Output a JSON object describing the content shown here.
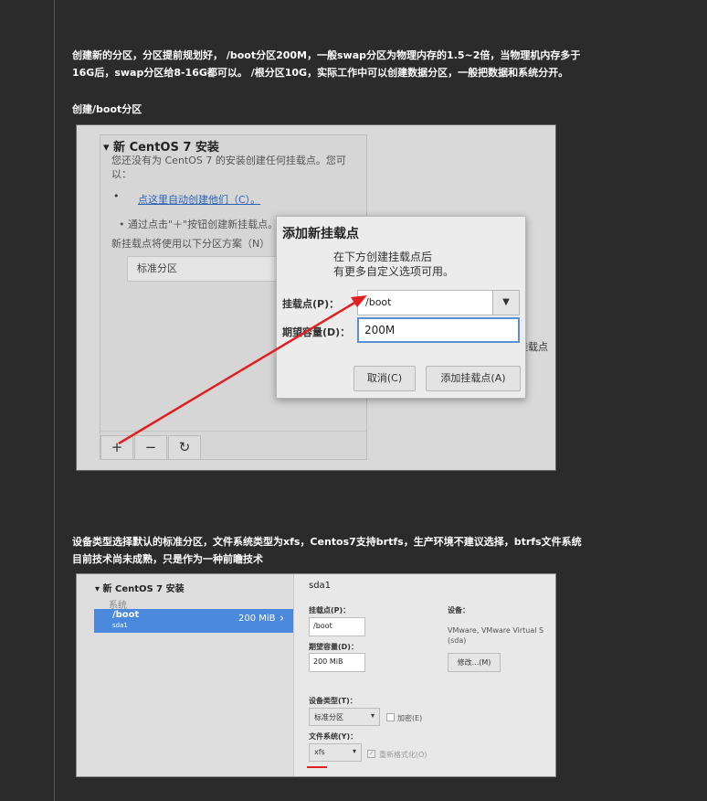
{
  "article": {
    "para1": "创建新的分区，分区提前规划好， /boot分区200M，一般swap分区为物理内存的1.5~2倍，当物理机内存多于16G后，swap分区给8-16G都可以。 /根分区10G，实际工作中可以创建数据分区，一般把数据和系统分开。",
    "heading_boot": "创建/boot分区",
    "para2": " 设备类型选择默认的标准分区，文件系统类型为xfs，Centos7支持brtfs，生产环境不建议选择，btrfs文件系统目前技术尚未成熟，只是作为一种前瞻技术"
  },
  "shot1": {
    "panel_title": "▾ 新 CentOS 7 安装",
    "panel_desc": "您还没有为 CentOS 7 的安装创建任何挂载点。您可以：",
    "bullet": "•",
    "auto_link": "点这里自动创建他们（C）。",
    "manual_hint": "• 通过点击\"＋\"按钮创建新挂载点。",
    "scheme_label": "新挂载点将使用以下分区方案（N）",
    "scheme_value": "标准分区",
    "btn_add": "+",
    "btn_remove": "−",
    "btn_refresh": "↻",
    "right_fragment": "挂载点",
    "dialog": {
      "title": "添加新挂载点",
      "subtitle": "在下方创建挂载点后\n有更多自定义选项可用。",
      "mount_label": "挂载点(P)：",
      "mount_value": "/boot",
      "dropdown_icon": "▼",
      "capacity_label": "期望容量(D)：",
      "capacity_value": "200M",
      "cancel": "取消(C)",
      "add": "添加挂载点(A)"
    }
  },
  "shot2": {
    "tree_title": "▾ 新 CentOS 7 安装",
    "section_system": "系统",
    "row": {
      "name": "/boot",
      "device": "sda1",
      "size": "200 MiB",
      "chevron": "›"
    },
    "heading": "sda1",
    "mount_label": "挂载点(P)：",
    "mount_value": "/boot",
    "capacity_label": "期望容量(D)：",
    "capacity_value": "200 MiB",
    "device_label": "设备：",
    "device_value": "VMware, VMware Virtual S (sda)",
    "modify_button": "修改...(M)",
    "device_type_label": "设备类型(T)：",
    "device_type_value": "标准分区",
    "encrypt_label": "加密(E)",
    "fs_label": "文件系统(Y)：",
    "fs_value": "xfs",
    "reformat_label": "重新格式化(O)",
    "dropdown_icon": "▾",
    "check_mark": "✓"
  }
}
